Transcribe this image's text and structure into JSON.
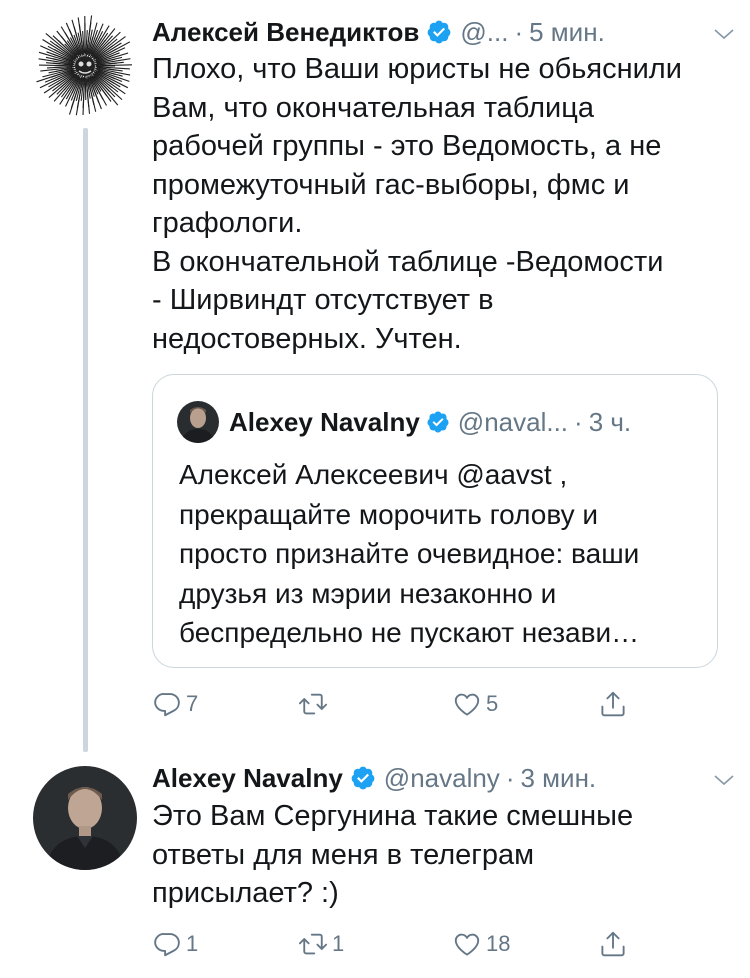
{
  "tweets": [
    {
      "author": "Алексей Венедиктов",
      "handle": "@...",
      "dot": "·",
      "time": "5 мин.",
      "text": "Плохо, что Ваши юристы не обьяснили\nВам, что окончательная таблица\nрабочей группы - это Ведомость, а не\nпромежуточный гас-выборы,  фмс и\nграфологи.\nВ окончательной таблице -Ведомости\n- Ширвиндт отсутствует в\nнедостоверных. Учтен.",
      "quoted": {
        "author": "Alexey Navalny",
        "handle": "@naval...",
        "dot": "·",
        "time": "3 ч.",
        "text": "Алексей Алексеевич @aavst ,\nпрекращайте морочить голову и\nпросто признайте очевидное: ваши\nдрузья из мэрии незаконно и\nбеспредельно не пускают незави…"
      },
      "actions": {
        "replies": "7",
        "retweets": "",
        "likes": "5"
      }
    },
    {
      "author": "Alexey Navalny",
      "handle": "@navalny",
      "dot": "·",
      "time": "3 мин.",
      "text": "Это Вам Сергунина такие смешные\nответы для меня в телеграм\nприсылает? :)",
      "actions": {
        "replies": "1",
        "retweets": "1",
        "likes": "18"
      }
    }
  ],
  "colors": {
    "text": "#14171a",
    "secondary": "#657786",
    "verified": "#1da1f2",
    "border": "#ccd6dd",
    "thread_line": "#cdd6dd"
  },
  "icons": [
    "verified-badge-icon",
    "chevron-down-icon",
    "reply-icon",
    "retweet-icon",
    "like-icon",
    "share-icon"
  ]
}
